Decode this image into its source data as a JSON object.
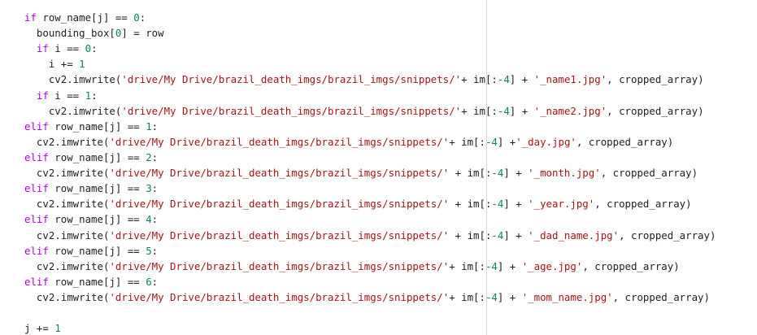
{
  "colors": {
    "background": "#ffffff",
    "text": "#212121",
    "keyword": "#af00db",
    "number": "#098658",
    "string": "#a31515",
    "ruler": "#d9d9d9"
  },
  "code_lines": [
    [
      {
        "t": "if",
        "c": "kw"
      },
      {
        "t": " row_name[j] == ",
        "c": "txt"
      },
      {
        "t": "0",
        "c": "num"
      },
      {
        "t": ":",
        "c": "txt"
      }
    ],
    [
      {
        "t": "  bounding_box[",
        "c": "txt"
      },
      {
        "t": "0",
        "c": "num"
      },
      {
        "t": "] = row",
        "c": "txt"
      }
    ],
    [
      {
        "t": "  ",
        "c": "txt"
      },
      {
        "t": "if",
        "c": "kw"
      },
      {
        "t": " i == ",
        "c": "txt"
      },
      {
        "t": "0",
        "c": "num"
      },
      {
        "t": ":",
        "c": "txt"
      }
    ],
    [
      {
        "t": "    i += ",
        "c": "txt"
      },
      {
        "t": "1",
        "c": "num"
      }
    ],
    [
      {
        "t": "    cv2.imwrite(",
        "c": "txt"
      },
      {
        "t": "'drive/My Drive/brazil_death_imgs/brazil_imgs/snippets/'",
        "c": "str"
      },
      {
        "t": "+ im[:",
        "c": "txt"
      },
      {
        "t": "-4",
        "c": "num"
      },
      {
        "t": "] + ",
        "c": "txt"
      },
      {
        "t": "'_name1.jpg'",
        "c": "str"
      },
      {
        "t": ", cropped_array)",
        "c": "txt"
      }
    ],
    [
      {
        "t": "  ",
        "c": "txt"
      },
      {
        "t": "if",
        "c": "kw"
      },
      {
        "t": " i == ",
        "c": "txt"
      },
      {
        "t": "1",
        "c": "num"
      },
      {
        "t": ":",
        "c": "txt"
      }
    ],
    [
      {
        "t": "    cv2.imwrite(",
        "c": "txt"
      },
      {
        "t": "'drive/My Drive/brazil_death_imgs/brazil_imgs/snippets/'",
        "c": "str"
      },
      {
        "t": "+ im[:",
        "c": "txt"
      },
      {
        "t": "-4",
        "c": "num"
      },
      {
        "t": "] + ",
        "c": "txt"
      },
      {
        "t": "'_name2.jpg'",
        "c": "str"
      },
      {
        "t": ", cropped_array)",
        "c": "txt"
      }
    ],
    [
      {
        "t": "elif",
        "c": "kw"
      },
      {
        "t": " row_name[j] == ",
        "c": "txt"
      },
      {
        "t": "1",
        "c": "num"
      },
      {
        "t": ":",
        "c": "txt"
      }
    ],
    [
      {
        "t": "  cv2.imwrite(",
        "c": "txt"
      },
      {
        "t": "'drive/My Drive/brazil_death_imgs/brazil_imgs/snippets/'",
        "c": "str"
      },
      {
        "t": "+ im[:",
        "c": "txt"
      },
      {
        "t": "-4",
        "c": "num"
      },
      {
        "t": "] +",
        "c": "txt"
      },
      {
        "t": "'_day.jpg'",
        "c": "str"
      },
      {
        "t": ", cropped_array)",
        "c": "txt"
      }
    ],
    [
      {
        "t": "elif",
        "c": "kw"
      },
      {
        "t": " row_name[j] == ",
        "c": "txt"
      },
      {
        "t": "2",
        "c": "num"
      },
      {
        "t": ":",
        "c": "txt"
      }
    ],
    [
      {
        "t": "  cv2.imwrite(",
        "c": "txt"
      },
      {
        "t": "'drive/My Drive/brazil_death_imgs/brazil_imgs/snippets/'",
        "c": "str"
      },
      {
        "t": " + im[:",
        "c": "txt"
      },
      {
        "t": "-4",
        "c": "num"
      },
      {
        "t": "] + ",
        "c": "txt"
      },
      {
        "t": "'_month.jpg'",
        "c": "str"
      },
      {
        "t": ", cropped_array)",
        "c": "txt"
      }
    ],
    [
      {
        "t": "elif",
        "c": "kw"
      },
      {
        "t": " row_name[j] == ",
        "c": "txt"
      },
      {
        "t": "3",
        "c": "num"
      },
      {
        "t": ":",
        "c": "txt"
      }
    ],
    [
      {
        "t": "  cv2.imwrite(",
        "c": "txt"
      },
      {
        "t": "'drive/My Drive/brazil_death_imgs/brazil_imgs/snippets/'",
        "c": "str"
      },
      {
        "t": " + im[:",
        "c": "txt"
      },
      {
        "t": "-4",
        "c": "num"
      },
      {
        "t": "] + ",
        "c": "txt"
      },
      {
        "t": "'_year.jpg'",
        "c": "str"
      },
      {
        "t": ", cropped_array)",
        "c": "txt"
      }
    ],
    [
      {
        "t": "elif",
        "c": "kw"
      },
      {
        "t": " row_name[j] == ",
        "c": "txt"
      },
      {
        "t": "4",
        "c": "num"
      },
      {
        "t": ":",
        "c": "txt"
      }
    ],
    [
      {
        "t": "  cv2.imwrite(",
        "c": "txt"
      },
      {
        "t": "'drive/My Drive/brazil_death_imgs/brazil_imgs/snippets/'",
        "c": "str"
      },
      {
        "t": " + im[:",
        "c": "txt"
      },
      {
        "t": "-4",
        "c": "num"
      },
      {
        "t": "] + ",
        "c": "txt"
      },
      {
        "t": "'_dad_name.jpg'",
        "c": "str"
      },
      {
        "t": ", cropped_array)",
        "c": "txt"
      }
    ],
    [
      {
        "t": "elif",
        "c": "kw"
      },
      {
        "t": " row_name[j] == ",
        "c": "txt"
      },
      {
        "t": "5",
        "c": "num"
      },
      {
        "t": ":",
        "c": "txt"
      }
    ],
    [
      {
        "t": "  cv2.imwrite(",
        "c": "txt"
      },
      {
        "t": "'drive/My Drive/brazil_death_imgs/brazil_imgs/snippets/'",
        "c": "str"
      },
      {
        "t": "+ im[:",
        "c": "txt"
      },
      {
        "t": "-4",
        "c": "num"
      },
      {
        "t": "] + ",
        "c": "txt"
      },
      {
        "t": "'_age.jpg'",
        "c": "str"
      },
      {
        "t": ", cropped_array)",
        "c": "txt"
      }
    ],
    [
      {
        "t": "elif",
        "c": "kw"
      },
      {
        "t": " row_name[j] == ",
        "c": "txt"
      },
      {
        "t": "6",
        "c": "num"
      },
      {
        "t": ":",
        "c": "txt"
      }
    ],
    [
      {
        "t": "  cv2.imwrite(",
        "c": "txt"
      },
      {
        "t": "'drive/My Drive/brazil_death_imgs/brazil_imgs/snippets/'",
        "c": "str"
      },
      {
        "t": "+ im[:",
        "c": "txt"
      },
      {
        "t": "-4",
        "c": "num"
      },
      {
        "t": "] + ",
        "c": "txt"
      },
      {
        "t": "'_mom_name.jpg'",
        "c": "str"
      },
      {
        "t": ", cropped_array)",
        "c": "txt"
      }
    ],
    [],
    [
      {
        "t": "j += ",
        "c": "txt"
      },
      {
        "t": "1",
        "c": "num"
      }
    ]
  ]
}
